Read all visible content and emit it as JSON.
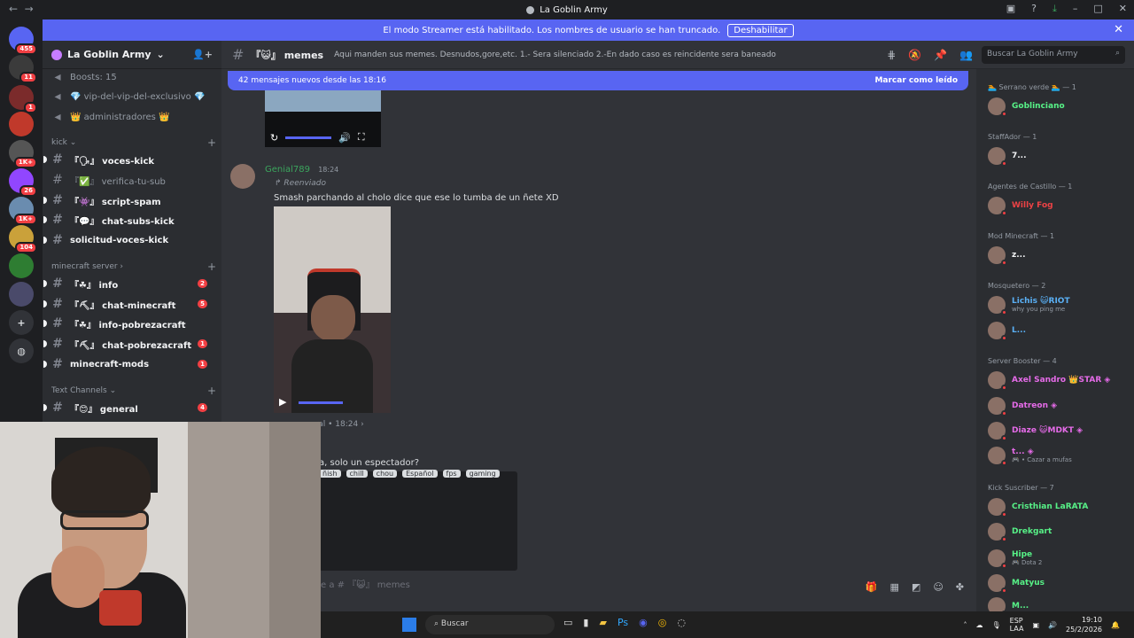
{
  "window": {
    "title": "La Goblin Army"
  },
  "streamer_banner": {
    "text": "El modo Streamer está habilitado. Los nombres de usuario se han truncado.",
    "button": "Deshabilitar"
  },
  "servers": [
    {
      "label": "",
      "badge": "455",
      "color": "#5865f2"
    },
    {
      "label": "",
      "badge": "11",
      "color": "#3b3b3b"
    },
    {
      "label": "",
      "badge": "1",
      "color": "#7b2b2b"
    },
    {
      "label": "",
      "badge": "",
      "color": "#c0392b"
    },
    {
      "label": "",
      "badge": "1K+",
      "color": "#555"
    },
    {
      "label": "",
      "badge": "26",
      "color": "#9146ff"
    },
    {
      "label": "",
      "badge": "1K+",
      "color": "#6a8caf"
    },
    {
      "label": "",
      "badge": "104",
      "color": "#caa13a"
    },
    {
      "label": "",
      "badge": "",
      "color": "#2e7d32"
    },
    {
      "label": "",
      "badge": "",
      "color": "#4a4a6a"
    }
  ],
  "sidebar": {
    "server_name": "La Goblin Army",
    "items": [
      {
        "label": "Boosts: 15"
      },
      {
        "label": "💎 vip-del-vip-del-exclusivo 💎"
      },
      {
        "label": "👑 administradores 👑"
      }
    ],
    "categories": [
      {
        "label": "kick"
      },
      {
        "label": "minecraft server"
      },
      {
        "label": "Text Channels"
      }
    ],
    "channels": [
      {
        "label": "『🗣』 voces-kick",
        "badge": ""
      },
      {
        "label": "『✅』 verifica-tu-sub",
        "badge": ""
      },
      {
        "label": "『👾』 script-spam",
        "badge": ""
      },
      {
        "label": "『💬』 chat-subs-kick",
        "badge": ""
      },
      {
        "label": "solicitud-voces-kick",
        "badge": ""
      },
      {
        "label": "『☘』 info",
        "badge": "2"
      },
      {
        "label": "『⛏』 chat-minecraft",
        "badge": "5"
      },
      {
        "label": "『☘』 info-pobrezacraft",
        "badge": ""
      },
      {
        "label": "『⛏』 chat-pobrezacraft",
        "badge": "1"
      },
      {
        "label": "minecraft-mods",
        "badge": "1"
      },
      {
        "label": "『😊』 general",
        "badge": "4"
      }
    ]
  },
  "topbar": {
    "channel": "『😺』 memes",
    "topic": "Aqui manden sus memes. Desnudos,gore,etc. 1.- Sera silenciado 2.-En dado caso es reincidente sera baneado",
    "search_placeholder": "Buscar La Goblin Army"
  },
  "chat": {
    "new_messages": "42 mensajes nuevos desde las 18:16",
    "mark_read": "Marcar como leído",
    "message": {
      "author": "Genial789",
      "time": "18:24",
      "forwarded": "Reenviado",
      "text": "Smash parchando al cholo dice que ese lo tumba de un ñete XD"
    },
    "reply": {
      "meta": "eral • 18:24 ›",
      "time": "18:24",
      "text": "a, solo un espectador?",
      "tags": [
        "ñish",
        "chill",
        "chou",
        "Español",
        "fps",
        "gaming"
      ]
    },
    "input_placeholder": "e a # 『😺』 memes"
  },
  "members": {
    "roles": [
      {
        "label": "🏊 Serrano verde 🏊 — 1"
      },
      {
        "label": "StaffAdor — 1"
      },
      {
        "label": "Agentes de Castillo — 1"
      },
      {
        "label": "Mod Minecraft — 1"
      },
      {
        "label": "Mosquetero — 2"
      },
      {
        "label": "Server Booster — 4"
      },
      {
        "label": "Kick Suscriber — 7"
      }
    ],
    "list": [
      {
        "name": "Goblinciano",
        "sub": "",
        "color": "#57f287"
      },
      {
        "name": "7...",
        "sub": "",
        "color": "#f2f3f5"
      },
      {
        "name": "Willy Fog",
        "sub": "",
        "color": "#ed4245"
      },
      {
        "name": "z...",
        "sub": "",
        "color": "#f2f3f5"
      },
      {
        "name": "Lichis 😺RIOT",
        "sub": "why you ping me",
        "color": "#5ab0f5"
      },
      {
        "name": "L...",
        "sub": "",
        "color": "#5ab0f5"
      },
      {
        "name": "Axel Sandro 👑STAR ◈",
        "sub": "",
        "color": "#e56be8"
      },
      {
        "name": "Datreon ◈",
        "sub": "",
        "color": "#e56be8"
      },
      {
        "name": "Diaze 😺MDKT ◈",
        "sub": "",
        "color": "#e56be8"
      },
      {
        "name": "t... ◈",
        "sub": "🎮 • Cazar a mufas",
        "color": "#e56be8"
      },
      {
        "name": "Cristhian LaRATA",
        "sub": "",
        "color": "#57f287"
      },
      {
        "name": "Drekgart",
        "sub": "",
        "color": "#57f287"
      },
      {
        "name": "Hipe",
        "sub": "🎮 Dota 2",
        "color": "#57f287"
      },
      {
        "name": "Matyus",
        "sub": "",
        "color": "#57f287"
      },
      {
        "name": "M...",
        "sub": "",
        "color": "#57f287"
      }
    ]
  },
  "taskbar": {
    "search": "Buscar",
    "lang": "ESP\nLAA",
    "time": "19:10",
    "date": "25/2/2026"
  }
}
